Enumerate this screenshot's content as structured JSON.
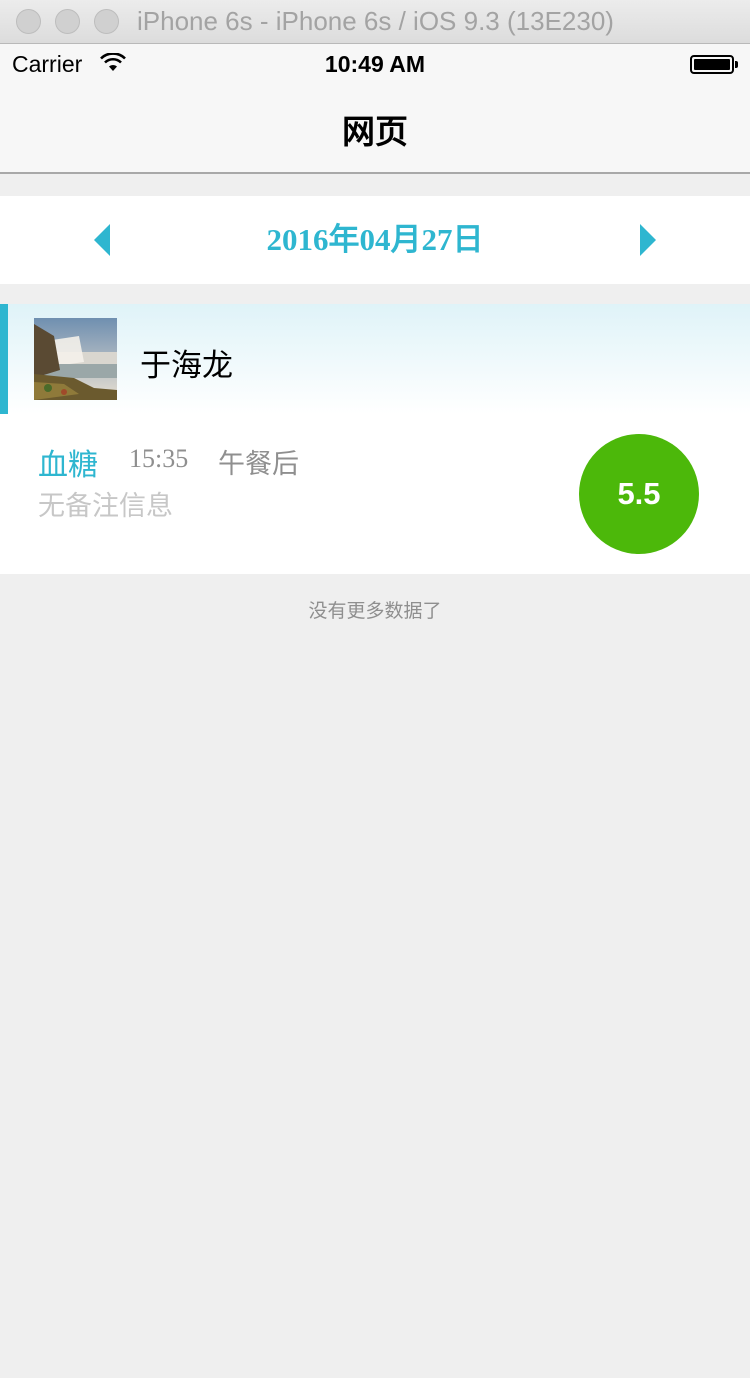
{
  "window": {
    "title": "iPhone 6s - iPhone 6s / iOS 9.3 (13E230)"
  },
  "status_bar": {
    "carrier": "Carrier",
    "time": "10:49 AM",
    "wifi_icon": "wifi-icon",
    "battery_icon": "battery-icon",
    "battery_level": 1.0
  },
  "nav": {
    "title": "网页"
  },
  "date_selector": {
    "date": "2016年04月27日",
    "prev_icon": "caret-left-icon",
    "next_icon": "caret-right-icon"
  },
  "patient": {
    "name": "于海龙",
    "avatar_icon": "waterfall-landscape-photo"
  },
  "record": {
    "type": "血糖",
    "time": "15:35",
    "period": "午餐后",
    "note": "无备注信息",
    "value": "5.5"
  },
  "footer": {
    "no_more_text": "没有更多数据了"
  },
  "colors": {
    "accent": "#2eb6d0",
    "value_circle": "#4cb80a",
    "background": "#efefef"
  }
}
